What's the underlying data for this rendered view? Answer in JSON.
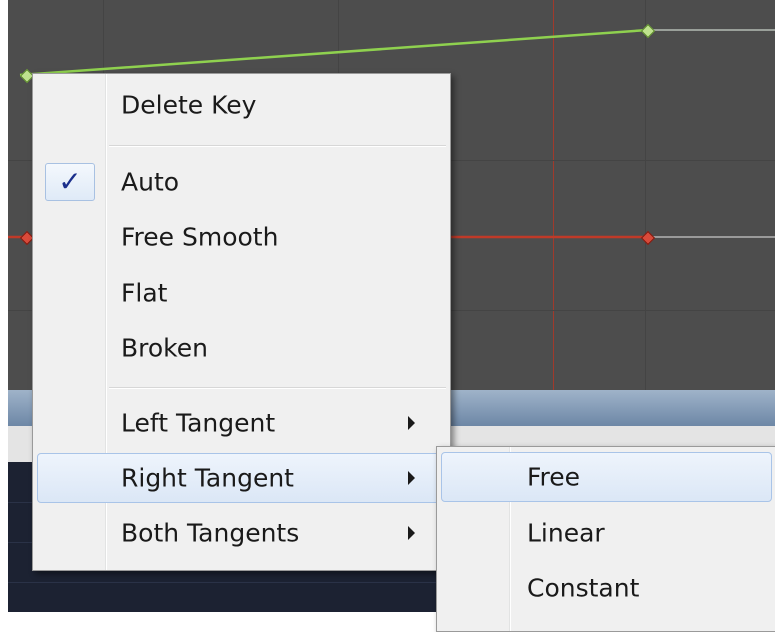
{
  "colors": {
    "curve_green": "#8fd14f",
    "curve_red": "#c03a28",
    "key_red": "#d84a3a",
    "menu_bg": "#f0f0f0",
    "highlight_border": "#a9c4e8",
    "check_color": "#1b2f8c"
  },
  "context_menu": {
    "delete_key": "Delete Key",
    "modes": [
      {
        "label": "Auto",
        "checked": true,
        "check_glyph": "✓"
      },
      {
        "label": "Free Smooth",
        "checked": false
      },
      {
        "label": "Flat",
        "checked": false
      },
      {
        "label": "Broken",
        "checked": false
      }
    ],
    "tangents": [
      {
        "label": "Left Tangent",
        "has_submenu": true,
        "highlighted": false
      },
      {
        "label": "Right Tangent",
        "has_submenu": true,
        "highlighted": true
      },
      {
        "label": "Both Tangents",
        "has_submenu": true,
        "highlighted": false
      }
    ]
  },
  "submenu": {
    "items": [
      {
        "label": "Free",
        "highlighted": true
      },
      {
        "label": "Linear",
        "highlighted": false
      },
      {
        "label": "Constant",
        "highlighted": false
      }
    ]
  }
}
